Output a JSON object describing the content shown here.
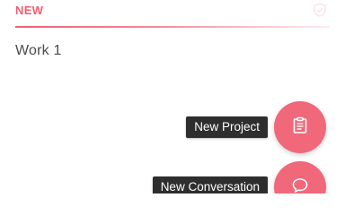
{
  "section": {
    "title": "NEW",
    "header_icon": "shield-icon"
  },
  "list": {
    "items": [
      {
        "label": "Work 1"
      }
    ]
  },
  "fab_menu": {
    "items": [
      {
        "label": "New Project",
        "icon": "clipboard-icon"
      },
      {
        "label": "New Conversation",
        "icon": "chat-bubble-icon"
      }
    ]
  },
  "colors": {
    "accent": "#ef5f73",
    "fab": "#f0687a",
    "label_bg": "#2e2e2e",
    "text": "#4a4a4a"
  }
}
